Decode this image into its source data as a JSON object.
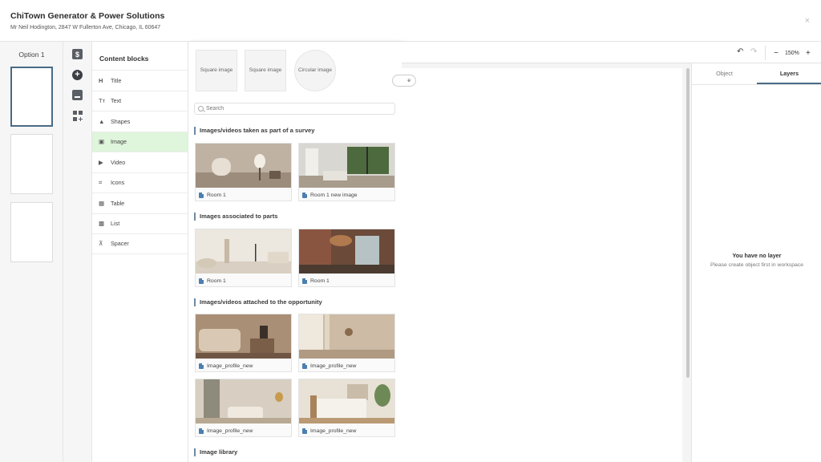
{
  "header": {
    "title": "ChiTown Generator & Power Solutions",
    "subtitle": "Mr Neil Hodington, 2847 W Fullerton Ave, Chicago, IL 60647",
    "close_icon": "×"
  },
  "options": {
    "label": "Option 1"
  },
  "rail": {
    "dollar_glyph": "$",
    "plus_glyph": "+"
  },
  "blocks": {
    "heading": "Content blocks",
    "items": [
      {
        "icon": "H",
        "label": "Title"
      },
      {
        "icon": "Tт",
        "label": "Text"
      },
      {
        "icon": "▲",
        "label": "Shapes"
      },
      {
        "icon": "▣",
        "label": "Image"
      },
      {
        "icon": "▶",
        "label": "Video"
      },
      {
        "icon": "⌗",
        "label": "Icons"
      },
      {
        "icon": "▦",
        "label": "Table"
      },
      {
        "icon": "▩",
        "label": "List"
      },
      {
        "icon": "⊼",
        "label": "Spacer"
      }
    ]
  },
  "picker": {
    "shapes": [
      "Square image",
      "Square image",
      "Circular image"
    ],
    "search_placeholder": "Search",
    "sections": [
      {
        "title": "Images/videos taken as part of a survey",
        "items": [
          "Room 1",
          "Room 1 new image"
        ]
      },
      {
        "title": "Images associated to parts",
        "items": [
          "Room 1",
          "Room 1"
        ]
      },
      {
        "title": "Images/videos attached to the opportunity",
        "items": [
          "Image_profile_new",
          "Image_profile_new",
          "Image_profile_new",
          "Image_profile_new"
        ]
      },
      {
        "title": "Image library",
        "items": []
      }
    ]
  },
  "toolbar": {
    "undo_glyph": "↶",
    "redo_glyph": "↷",
    "zoom_minus": "−",
    "zoom_value": "150%",
    "zoom_plus": "+"
  },
  "canvas": {
    "pill_label": "e"
  },
  "right": {
    "tabs": [
      "Object",
      "Layers"
    ],
    "empty_title": "You have no layer",
    "empty_text": "Please create object first in workspace"
  }
}
